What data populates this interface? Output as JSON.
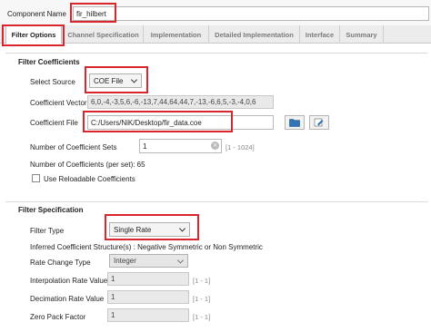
{
  "header": {
    "component_name_label": "Component Name",
    "component_name_value": "fir_hilbert"
  },
  "tabs": [
    {
      "label": "Filter Options",
      "active": true
    },
    {
      "label": "Channel Specification",
      "active": false
    },
    {
      "label": "Implementation",
      "active": false
    },
    {
      "label": "Detailed Implementation",
      "active": false
    },
    {
      "label": "Interface",
      "active": false
    },
    {
      "label": "Summary",
      "active": false
    }
  ],
  "filter_coefficients": {
    "section_title": "Filter Coefficients",
    "select_source_label": "Select Source",
    "select_source_value": "COE File",
    "coefficient_vector_label": "Coefficient Vector",
    "coefficient_vector_value": "6,0,-4,-3,5,6,-6,-13,7,44,64,44,7,-13,-6,6,5,-3,-4,0,6",
    "coefficient_file_label": "Coefficient File",
    "coefficient_file_value": "C:/Users/NiK/Desktop/fir_data.coe",
    "num_sets_label": "Number of Coefficient Sets",
    "num_sets_value": "1",
    "num_sets_range": "[1 - 1024]",
    "num_per_set_text": "Number of Coefficients (per set): 65",
    "reloadable_label": "Use Reloadable Coefficients"
  },
  "filter_specification": {
    "section_title": "Filter Specification",
    "filter_type_label": "Filter Type",
    "filter_type_value": "Single Rate",
    "inferred_text": "Inferred Coefficient Structure(s) : Negative Symmetric or Non Symmetric",
    "rate_change_label": "Rate Change Type",
    "rate_change_value": "Integer",
    "interp_label": "Interpolation Rate Value",
    "interp_value": "1",
    "interp_range": "[1 - 1]",
    "decim_label": "Decimation Rate Value",
    "decim_value": "1",
    "decim_range": "[1 - 1]",
    "zero_pack_label": "Zero Pack Factor",
    "zero_pack_value": "1",
    "zero_pack_range": "[1 - 1]"
  },
  "colors": {
    "highlight": "#d8262c",
    "folder_icon": "#2f74b5"
  },
  "icons": [
    "folder-icon",
    "edit-icon",
    "clear-icon",
    "chevron-down-icon"
  ]
}
